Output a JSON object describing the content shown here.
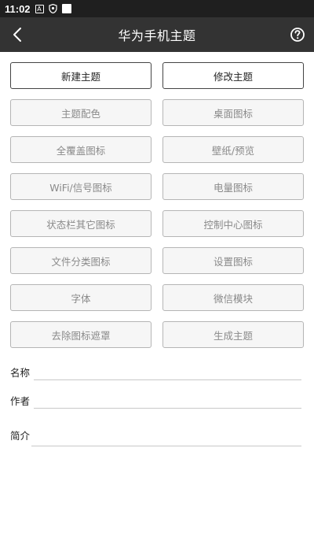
{
  "status_bar": {
    "time": "11:02",
    "icons": [
      "notification-a-icon",
      "shield-icon",
      "square-icon"
    ]
  },
  "app_bar": {
    "title": "华为手机主题",
    "back_icon": "chevron-left-icon",
    "help_icon": "help-circle-icon"
  },
  "buttons": [
    {
      "label": "新建主题",
      "style": "primary"
    },
    {
      "label": "修改主题",
      "style": "primary"
    },
    {
      "label": "主题配色",
      "style": "disabled"
    },
    {
      "label": "桌面图标",
      "style": "disabled"
    },
    {
      "label": "全覆盖图标",
      "style": "disabled"
    },
    {
      "label": "壁纸/预览",
      "style": "disabled"
    },
    {
      "label": "WiFi/信号图标",
      "style": "disabled"
    },
    {
      "label": "电量图标",
      "style": "disabled"
    },
    {
      "label": "状态栏其它图标",
      "style": "disabled"
    },
    {
      "label": "控制中心图标",
      "style": "disabled"
    },
    {
      "label": "文件分类图标",
      "style": "disabled"
    },
    {
      "label": "设置图标",
      "style": "disabled"
    },
    {
      "label": "字体",
      "style": "disabled"
    },
    {
      "label": "微信模块",
      "style": "disabled"
    },
    {
      "label": "去除图标遮罩",
      "style": "disabled"
    },
    {
      "label": "生成主题",
      "style": "disabled"
    }
  ],
  "form": {
    "name_label": "名称",
    "name_value": "",
    "author_label": "作者",
    "author_value": "",
    "intro_label": "简介",
    "intro_value": ""
  },
  "colors": {
    "status_bar": "#1f1f1f",
    "app_bar": "#333333",
    "primary_border": "#444444",
    "disabled_text": "#8a8a8a"
  }
}
